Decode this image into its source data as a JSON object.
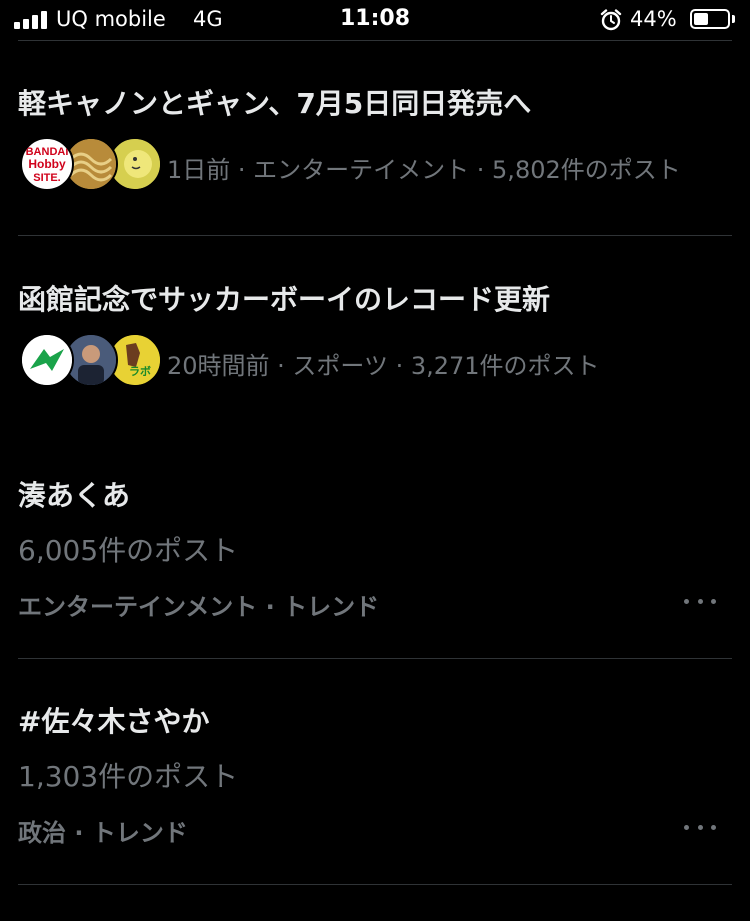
{
  "status_bar": {
    "carrier": "UQ mobile",
    "network": "4G",
    "time": "11:08",
    "battery_percent": "44%",
    "battery_level": 0.44,
    "icons": [
      "signal-icon",
      "alarm-icon",
      "battery-icon"
    ]
  },
  "news": [
    {
      "headline": "軽キャノンとギャン、7月5日同日発売へ",
      "meta": "1日前 · エンターテイメント · 5,802件のポスト",
      "avatar_icons": [
        "bandai-hobby-site-avatar",
        "noodle-avatar",
        "yellow-character-avatar"
      ],
      "avatar_text": [
        "BANDAI",
        "Hobby",
        "SITE."
      ]
    },
    {
      "headline": "函館記念でサッカーボーイのレコード更新",
      "meta": "20時間前 · スポーツ · 3,271件のポスト",
      "avatar_icons": [
        "green-logo-avatar",
        "person-photo-avatar",
        "horse-character-avatar"
      ],
      "avatar_text": [
        "ラボ"
      ]
    }
  ],
  "trends": [
    {
      "title": "湊あくあ",
      "count": "6,005件のポスト",
      "category": "エンターテインメント · トレンド",
      "more_icon": "more-dots-icon"
    },
    {
      "title": "#佐々木さやか",
      "count": "1,303件のポスト",
      "category": "政治 · トレンド",
      "more_icon": "more-dots-icon"
    }
  ],
  "colors": {
    "background": "#000000",
    "primary_text": "#e7e9ea",
    "secondary_text": "#71767b",
    "divider": "#2f3336"
  }
}
